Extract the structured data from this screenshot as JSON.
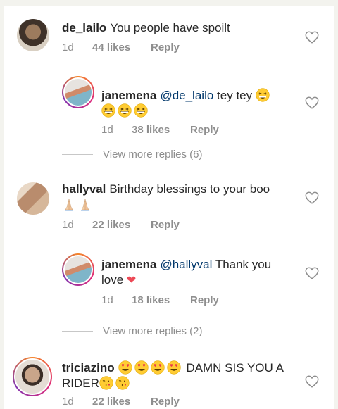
{
  "comments": [
    {
      "username": "de_lailo",
      "text": "You people have spoilt",
      "time": "1d",
      "likes": "44 likes",
      "reply": "Reply"
    },
    {
      "username": "janemena",
      "mention": "@de_lailo",
      "text": "tey tey",
      "time": "1d",
      "likes": "38 likes",
      "reply": "Reply"
    },
    {
      "view_more": "View more replies (6)"
    },
    {
      "username": "hallyval",
      "text": "Birthday blessings to your boo",
      "time": "1d",
      "likes": "22 likes",
      "reply": "Reply"
    },
    {
      "username": "janemena",
      "mention": "@hallyval",
      "text": "Thank you",
      "text2": "love",
      "time": "1d",
      "likes": "18 likes",
      "reply": "Reply"
    },
    {
      "view_more": "View more replies (2)"
    },
    {
      "username": "triciazino",
      "text": "DAMN SIS YOU A",
      "text2": "RIDER",
      "time": "1d",
      "likes": "22 likes",
      "reply": "Reply"
    }
  ],
  "icons": {
    "like": "heart-outline-icon",
    "grin": "grinning-squinting-face-emoji",
    "heart_eyes": "smiling-face-with-heart-eyes-emoji",
    "wink": "face-blowing-kiss-emoji",
    "pray": "folded-hands-emoji",
    "red_heart": "red-heart-emoji"
  },
  "colors": {
    "text": "#262626",
    "meta": "#8e8e8e",
    "mention": "#00376b",
    "heart": "#ed4956"
  }
}
